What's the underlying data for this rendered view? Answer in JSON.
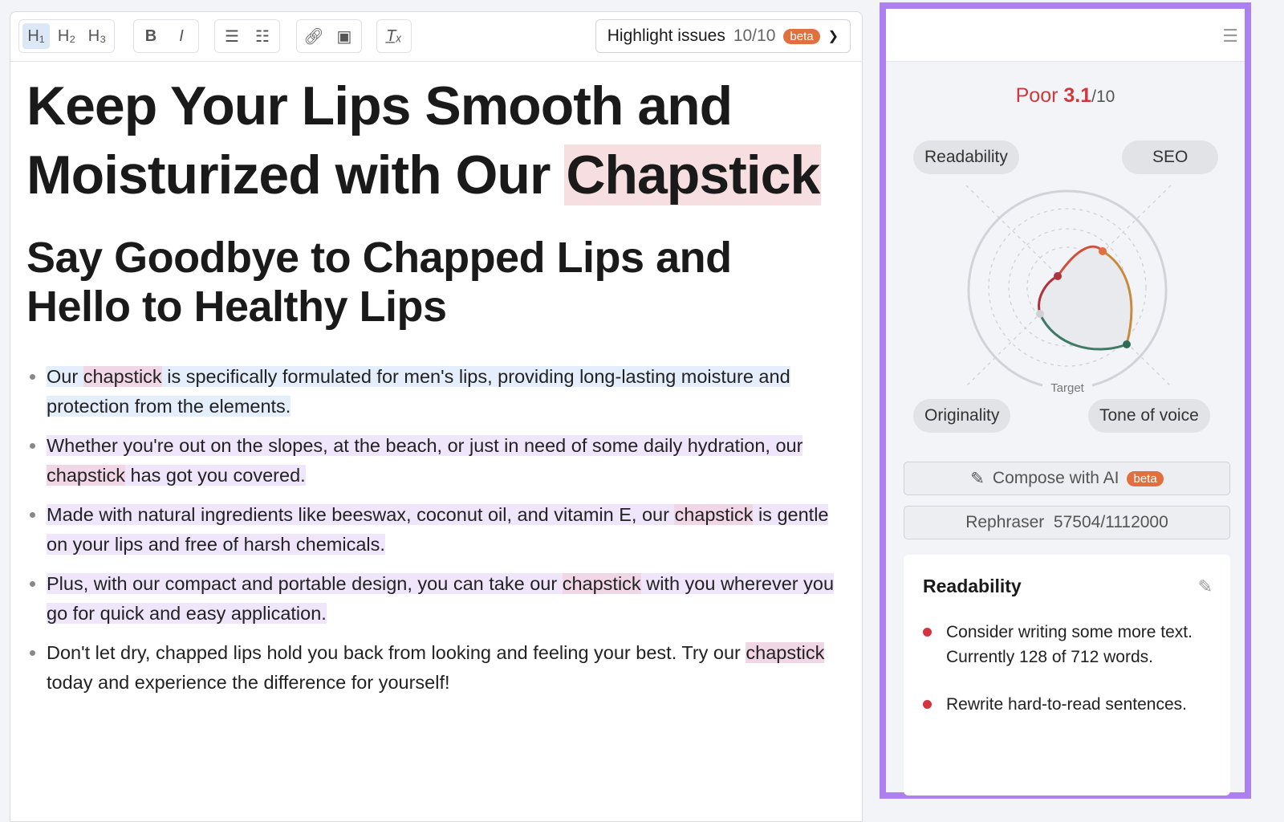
{
  "toolbar": {
    "h1": "H₁",
    "h2": "H₂",
    "h3": "H₃",
    "bold": "B",
    "italic": "I",
    "clear": "T̲ₓ",
    "highlight_label": "Highlight issues",
    "highlight_count": "10/10",
    "beta": "beta",
    "icons": [
      "ordered-list-icon",
      "bullet-list-icon",
      "link-icon",
      "image-icon",
      "chevron-down-icon"
    ]
  },
  "doc": {
    "title_parts": [
      "Keep Your Lips Smooth and Moisturized with Our ",
      "Chapstick"
    ],
    "subtitle": "Say Goodbye to Chapped Lips and Hello to Healthy Lips",
    "bullets": [
      {
        "a": "Our ",
        "k": "chapstick",
        "b": " is specifically formulated for men's lips, providing long-lasting moisture and protection from the elements."
      },
      {
        "a": "Whether you're out on the slopes, at the beach, or just in need of some daily hydration, our ",
        "k": "chapstick",
        "b": " has got you covered."
      },
      {
        "a": "Made with natural ingredients like beeswax, coconut oil, and vitamin E, our ",
        "k": "chapstick",
        "b": " is gentle on your lips and free of harsh chemicals."
      },
      {
        "a": "Plus, with our compact and portable design, you can take our ",
        "k": "chapstick",
        "b": " with you wherever you go for quick and easy application."
      },
      {
        "a": "Don't let dry, chapped lips hold you back from looking and feeling your best. Try our ",
        "k": "chapstick",
        "b": " today and experience the difference for yourself!"
      }
    ]
  },
  "panel": {
    "score_label": "Poor",
    "score": "3.1",
    "score_of": "/10",
    "tabs": [
      "Readability",
      "SEO",
      "Originality",
      "Tone of voice"
    ],
    "target": "Target",
    "compose": "Compose with AI",
    "compose_badge": "beta",
    "rephraser": "Rephraser  57504/1112000",
    "card": {
      "title": "Readability",
      "issues": [
        "Consider writing some more text. Currently 128 of 712 words.",
        "Rewrite hard-to-read sentences."
      ]
    },
    "colors": {
      "accent": "#ad80f2",
      "poor": "#d0383d",
      "beta": "#e0703e"
    }
  }
}
